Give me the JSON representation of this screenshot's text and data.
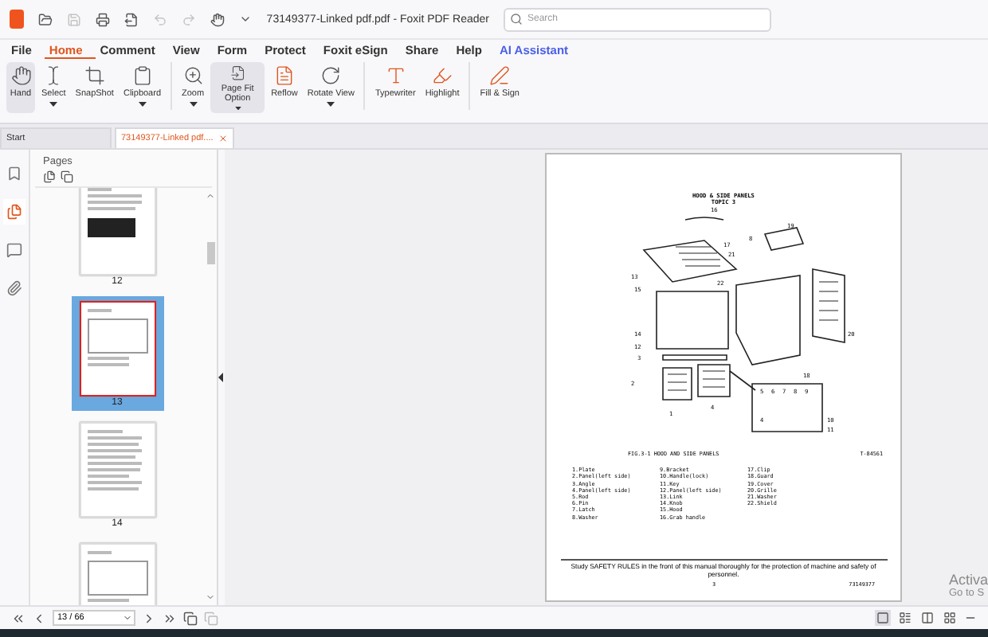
{
  "window": {
    "title": "73149377-Linked pdf.pdf - Foxit PDF Reader"
  },
  "search": {
    "placeholder": "Search"
  },
  "quick_toolbar": [
    {
      "kind": "open",
      "disabled": false
    },
    {
      "kind": "save",
      "disabled": true
    },
    {
      "kind": "print",
      "disabled": false
    },
    {
      "kind": "export",
      "disabled": false
    },
    {
      "kind": "undo",
      "disabled": true
    },
    {
      "kind": "redo",
      "disabled": true
    },
    {
      "kind": "hand",
      "disabled": false
    }
  ],
  "menu": [
    {
      "label": "File",
      "selected": false,
      "kind": "plain"
    },
    {
      "label": "Home",
      "selected": true,
      "kind": "plain"
    },
    {
      "label": "Comment",
      "selected": false,
      "kind": "plain"
    },
    {
      "label": "View",
      "selected": false,
      "kind": "plain"
    },
    {
      "label": "Form",
      "selected": false,
      "kind": "plain"
    },
    {
      "label": "Protect",
      "selected": false,
      "kind": "plain"
    },
    {
      "label": "Foxit eSign",
      "selected": false,
      "kind": "plain"
    },
    {
      "label": "Share",
      "selected": false,
      "kind": "plain"
    },
    {
      "label": "Help",
      "selected": false,
      "kind": "plain"
    },
    {
      "label": "AI Assistant",
      "selected": false,
      "kind": "ai"
    }
  ],
  "ribbon": [
    {
      "label": "Hand",
      "selected": true,
      "dropdown": false
    },
    {
      "label": "Select",
      "selected": false,
      "dropdown": true
    },
    {
      "label": "SnapShot",
      "selected": false,
      "dropdown": false
    },
    {
      "label": "Clipboard",
      "selected": false,
      "dropdown": true
    },
    {
      "label": "Zoom",
      "selected": false,
      "dropdown": true
    },
    {
      "label": "Page Fit Option",
      "selected": true,
      "dropdown": true
    },
    {
      "label": "Reflow",
      "selected": false,
      "dropdown": false
    },
    {
      "label": "Rotate View",
      "selected": false,
      "dropdown": true
    },
    {
      "label": "Typewriter",
      "selected": false,
      "dropdown": false
    },
    {
      "label": "Highlight",
      "selected": false,
      "dropdown": false
    },
    {
      "label": "Fill & Sign",
      "selected": false,
      "dropdown": false
    }
  ],
  "doc_tabs": [
    {
      "label": "Start",
      "selected": false,
      "closable": false
    },
    {
      "label": "73149377-Linked pdf....",
      "selected": true,
      "closable": true
    }
  ],
  "side_rail": [
    {
      "kind": "bookmark",
      "selected": false
    },
    {
      "kind": "pages",
      "selected": true
    },
    {
      "kind": "comments",
      "selected": false
    },
    {
      "kind": "attachments",
      "selected": false
    }
  ],
  "pages_panel": {
    "title": "Pages",
    "thumbnails": [
      {
        "label": "12",
        "kind": "photo",
        "selected": false
      },
      {
        "label": "13",
        "kind": "diagram",
        "selected": true
      },
      {
        "label": "14",
        "kind": "text",
        "selected": false
      },
      {
        "kind": "diagram",
        "selected": false
      }
    ]
  },
  "document_page": {
    "heading": "HOOD & SIDE PANELS",
    "subheading": "TOPIC 3",
    "callouts": [
      "16",
      "19",
      "8",
      "17",
      "21",
      "13",
      "15",
      "22",
      "14",
      "12",
      "20",
      "3",
      "18",
      "2",
      "1",
      "4",
      "5",
      "6",
      "7",
      "8",
      "9",
      "10",
      "11",
      "4"
    ],
    "caption": "FIG.3-1 HOOD AND SIDE PANELS",
    "figure_number": "T-84561",
    "parts": [
      [
        "1.Plate",
        "2.Panel(left side)",
        "3.Angle",
        "4.Panel(left side)",
        "5.Rod",
        "6.Pin",
        "7.Latch",
        "8.Washer"
      ],
      [
        "9.Bracket",
        "10.Handle(lock)",
        "11.Key",
        "12.Panel(left side)",
        "13.Link",
        "14.Knob",
        "15.Hood",
        "16.Grab handle"
      ],
      [
        "17.Clip",
        "18.Guard",
        "19.Cover",
        "20.Grille",
        "21.Washer",
        "22.Shield"
      ]
    ],
    "footer_note": "Study SAFETY RULES in the front of this manual thoroughly for the protection of machine and safety of personnel.",
    "page_number": "3",
    "doc_number": "73149377"
  },
  "status_bar": {
    "page_field": "13 / 66",
    "view_modes": [
      {
        "kind": "single",
        "selected": true
      },
      {
        "kind": "continuous",
        "selected": false
      },
      {
        "kind": "facing",
        "selected": false
      },
      {
        "kind": "cont-facing",
        "selected": false
      }
    ]
  },
  "activation_notice": [
    "Activa",
    "Go to S"
  ]
}
